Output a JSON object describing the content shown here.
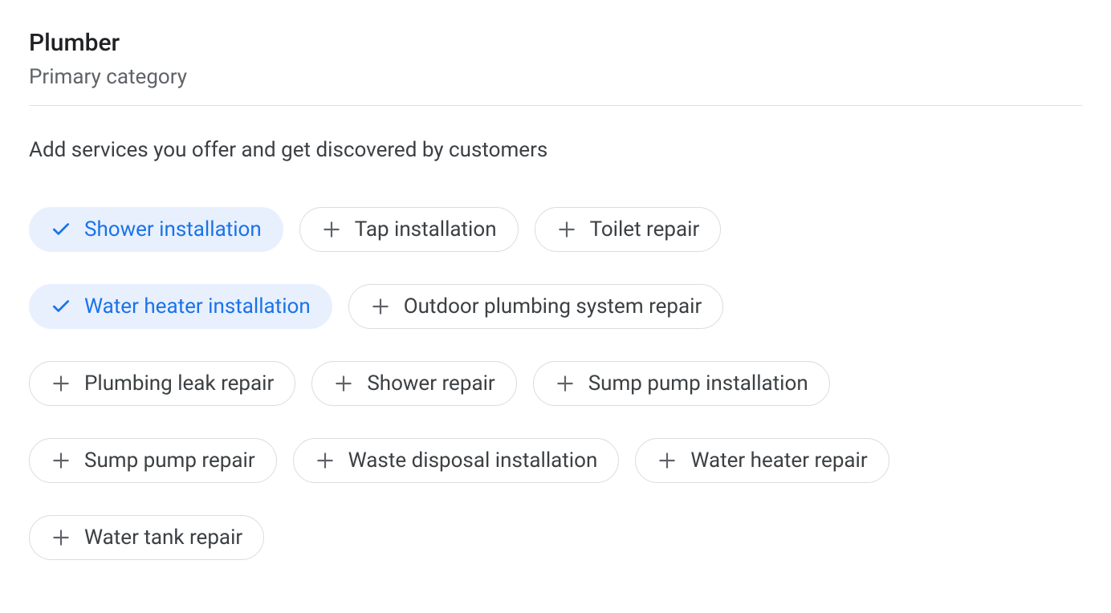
{
  "header": {
    "title": "Plumber",
    "subtitle": "Primary category"
  },
  "description": "Add services you offer and get discovered by customers",
  "services": [
    {
      "label": "Shower installation",
      "selected": true
    },
    {
      "label": "Tap installation",
      "selected": false
    },
    {
      "label": "Toilet repair",
      "selected": false
    },
    {
      "label": "Water heater installation",
      "selected": true
    },
    {
      "label": "Outdoor plumbing system repair",
      "selected": false
    },
    {
      "label": "Plumbing leak repair",
      "selected": false
    },
    {
      "label": "Shower repair",
      "selected": false
    },
    {
      "label": "Sump pump installation",
      "selected": false
    },
    {
      "label": "Sump pump repair",
      "selected": false
    },
    {
      "label": "Waste disposal installation",
      "selected": false
    },
    {
      "label": "Water heater repair",
      "selected": false
    },
    {
      "label": "Water tank repair",
      "selected": false
    }
  ],
  "row_breaks_after": [
    2,
    4,
    7,
    10
  ]
}
